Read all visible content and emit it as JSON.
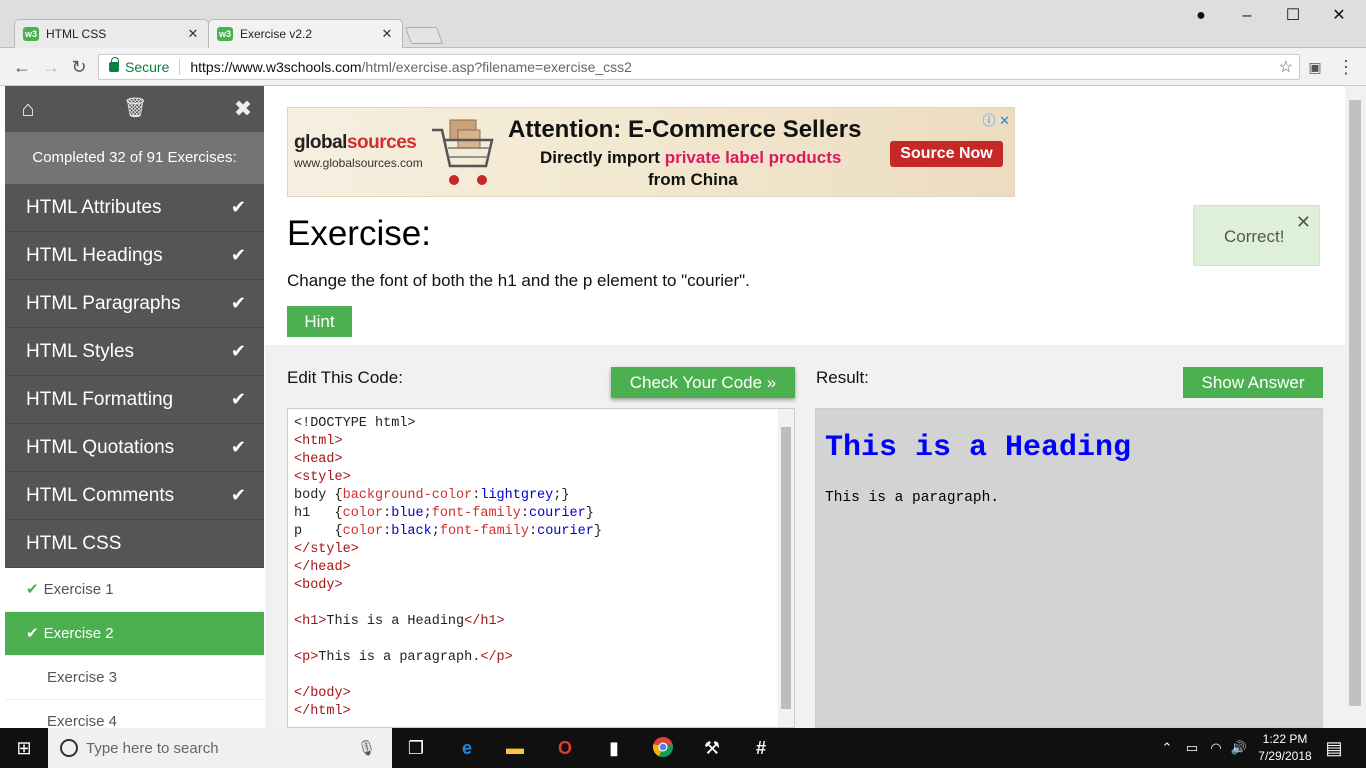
{
  "browser": {
    "tabs": [
      {
        "title": "HTML CSS",
        "favicon": "w3"
      },
      {
        "title": "Exercise v2.2",
        "favicon": "w3"
      }
    ],
    "secure_label": "Secure",
    "url_host": "https://www.w3schools.com",
    "url_path": "/html/exercise.asp?filename=exercise_css2"
  },
  "sidebar": {
    "progress": "Completed 32 of 91 Exercises:",
    "sections": [
      {
        "label": "HTML Attributes",
        "done": true
      },
      {
        "label": "HTML Headings",
        "done": true
      },
      {
        "label": "HTML Paragraphs",
        "done": true
      },
      {
        "label": "HTML Styles",
        "done": true
      },
      {
        "label": "HTML Formatting",
        "done": true
      },
      {
        "label": "HTML Quotations",
        "done": true
      },
      {
        "label": "HTML Comments",
        "done": true
      },
      {
        "label": "HTML CSS",
        "done": false
      }
    ],
    "exercises": [
      {
        "label": "Exercise 1",
        "done": true,
        "active": false
      },
      {
        "label": "Exercise 2",
        "done": true,
        "active": true
      },
      {
        "label": "Exercise 3",
        "done": false,
        "active": false
      },
      {
        "label": "Exercise 4",
        "done": false,
        "active": false
      }
    ]
  },
  "ad": {
    "logo_a": "global",
    "logo_b": "sources",
    "site": "www.globalsources.com",
    "headline": "Attention: E-Commerce Sellers",
    "line2_a": "Directly import ",
    "line2_b": "private label products",
    "line3": "from China",
    "cta": "Source Now"
  },
  "exercise": {
    "title": "Exercise:",
    "description": "Change the font of both the h1 and the p element to \"courier\".",
    "hint_label": "Hint",
    "correct_label": "Correct!",
    "edit_label": "Edit This Code:",
    "check_label": "Check Your Code »",
    "result_label": "Result:",
    "answer_label": "Show Answer"
  },
  "code": {
    "lines": [
      "<!DOCTYPE html>",
      "<html>",
      "<head>",
      "<style>",
      "body {background-color:lightgrey;}",
      "h1   {color:blue;font-family:courier}",
      "p    {color:black;font-family:courier}",
      "</style>",
      "</head>",
      "<body>",
      "",
      "<h1>This is a Heading</h1>",
      "",
      "<p>This is a paragraph.</p>",
      "",
      "</body>",
      "</html>"
    ]
  },
  "result": {
    "heading": "This is a Heading",
    "paragraph": "This is a paragraph."
  },
  "taskbar": {
    "search_placeholder": "Type here to search",
    "time": "1:22 PM",
    "date": "7/29/2018"
  },
  "colors": {
    "accent": "#4caf50",
    "sidebar_bg": "#555555",
    "tag": "#a31515",
    "keyword": "#d32f2f",
    "value": "#0000cd"
  }
}
